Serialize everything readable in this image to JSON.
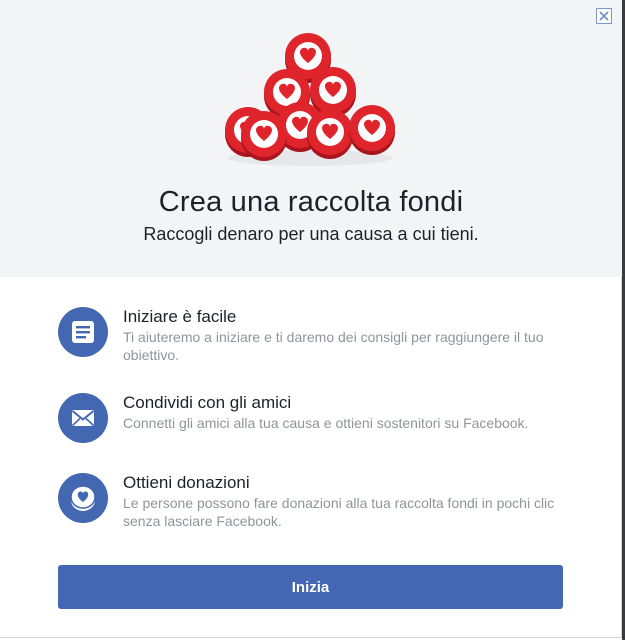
{
  "dialog": {
    "close_icon": "close-icon",
    "hero": {
      "illustration": "hearts-tokens-pyramid",
      "title": "Crea una raccolta fondi",
      "subtitle": "Raccogli denaro per una causa a cui tieni."
    },
    "features": [
      {
        "icon": "document-icon",
        "title": "Iniziare è facile",
        "description": "Ti aiuteremo a iniziare e ti daremo dei consigli per raggiungere il tuo obiettivo."
      },
      {
        "icon": "envelope-icon",
        "title": "Condividi con gli amici",
        "description": "Connetti gli amici alla tua causa e ottieni sostenitori su Facebook."
      },
      {
        "icon": "heart-coin-icon",
        "title": "Ottieni donazioni",
        "description": "Le persone possono fare donazioni alla tua raccolta fondi in pochi clic senza lasciare Facebook."
      }
    ],
    "primary_button": {
      "label": "Inizia"
    }
  },
  "colors": {
    "accent": "#4367b2",
    "hero_background": "#f3f4f6",
    "token_red": "#e0242c",
    "text_primary": "#1d2129",
    "text_secondary": "#90949c"
  }
}
